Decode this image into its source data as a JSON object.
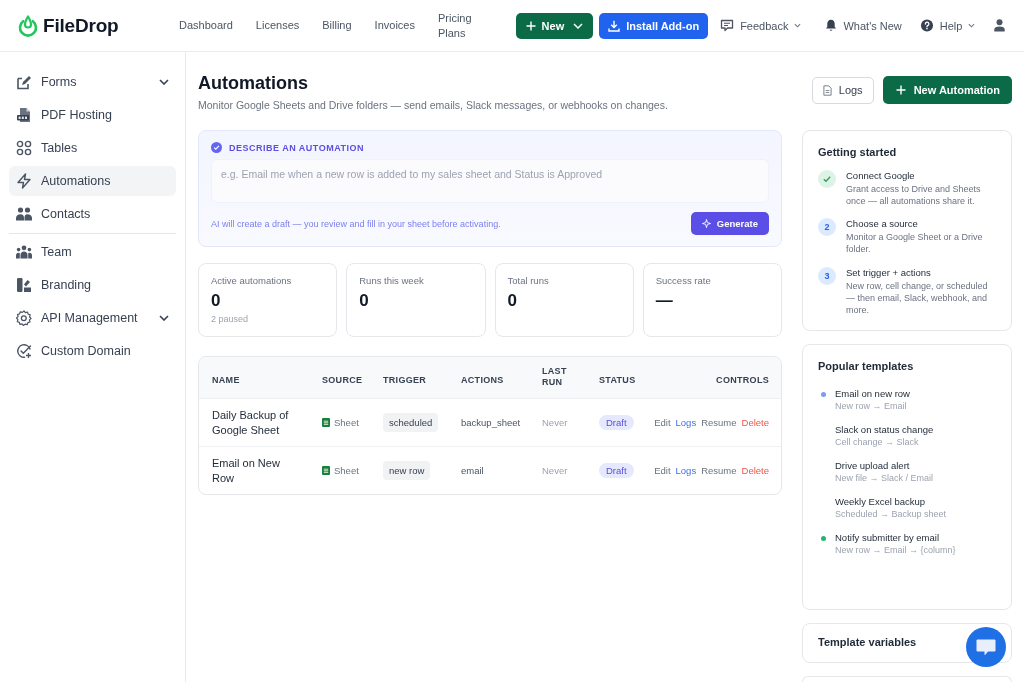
{
  "brand": {
    "name": "FileDrop"
  },
  "nav": [
    "Dashboard",
    "Licenses",
    "Billing",
    "Invoices",
    "Pricing Plans"
  ],
  "header_actions": {
    "new_button": "New",
    "install_button": "Install Add-on",
    "feedback": "Feedback",
    "whats_new": "What's New",
    "help": "Help"
  },
  "sidebar": {
    "sections": [
      {
        "items": [
          {
            "label": "Forms",
            "selected": false,
            "has_submenu": true
          },
          {
            "label": "PDF Hosting",
            "selected": false,
            "has_submenu": false
          },
          {
            "label": "Tables",
            "selected": false,
            "has_submenu": false
          },
          {
            "label": "Automations",
            "selected": true,
            "has_submenu": false
          },
          {
            "label": "Contacts",
            "selected": false,
            "has_submenu": false
          }
        ]
      },
      {
        "items": [
          {
            "label": "Team",
            "selected": false,
            "has_submenu": false
          },
          {
            "label": "Branding",
            "selected": false,
            "has_submenu": false
          },
          {
            "label": "API Management",
            "selected": false,
            "has_submenu": true
          },
          {
            "label": "Custom Domain",
            "selected": false,
            "has_submenu": false
          }
        ]
      }
    ]
  },
  "page": {
    "title": "Automations",
    "subtitle": "Monitor Google Sheets and Drive folders — send emails, Slack messages, or webhooks on changes.",
    "logs_button": "Logs",
    "new_button": "New Automation"
  },
  "ai_card": {
    "heading": "DESCRIBE AN AUTOMATION",
    "placeholder": "e.g. Email me when a new row is added to my sales sheet and Status is Approved",
    "hint": "AI will create a draft — you review and fill in your sheet before activating.",
    "button": "Generate"
  },
  "stats": [
    {
      "label": "Active automations",
      "value": "0",
      "note": "2 paused"
    },
    {
      "label": "Runs this week",
      "value": "0"
    },
    {
      "label": "Total runs",
      "value": "0"
    },
    {
      "label": "Success rate",
      "value": "—"
    }
  ],
  "table": {
    "columns": [
      "NAME",
      "SOURCE",
      "TRIGGER",
      "ACTIONS",
      "LAST RUN",
      "STATUS",
      "CONTROLS"
    ],
    "rows": [
      {
        "name": "Daily Backup of Google Sheet",
        "source": "Sheet",
        "trigger": "scheduled",
        "actions": "backup_sheet",
        "last_run": "Never",
        "status": "Draft",
        "controls": [
          {
            "label": "Edit",
            "kind": "plain"
          },
          {
            "label": "Logs",
            "kind": "link"
          },
          {
            "label": "Resume",
            "kind": "plain"
          },
          {
            "label": "Delete",
            "kind": "danger"
          }
        ]
      },
      {
        "name": "Email on New Row",
        "source": "Sheet",
        "trigger": "new row",
        "actions": "email",
        "last_run": "Never",
        "status": "Draft",
        "controls": [
          {
            "label": "Edit",
            "kind": "plain"
          },
          {
            "label": "Logs",
            "kind": "link"
          },
          {
            "label": "Resume",
            "kind": "plain"
          },
          {
            "label": "Delete",
            "kind": "danger"
          }
        ]
      }
    ]
  },
  "getting_started": {
    "title": "Getting started",
    "steps": [
      {
        "title": "Connect Google",
        "description": "Grant access to Drive and Sheets once — all automations share it.",
        "done": true
      },
      {
        "number": "2",
        "title": "Choose a source",
        "description": "Monitor a Google Sheet or a Drive folder.",
        "done": false
      },
      {
        "number": "3",
        "title": "Set trigger + actions",
        "description": "New row, cell change, or scheduled — then email, Slack, webhook, and more.",
        "done": false
      }
    ]
  },
  "popular_templates": {
    "title": "Popular templates",
    "items": [
      {
        "title": "Email on new row",
        "subtitle": "New row → Email",
        "color": "#7b9cf0"
      },
      {
        "title": "Slack on status change",
        "subtitle": "Cell change → Slack"
      },
      {
        "title": "Drive upload alert",
        "subtitle": "New file → Slack / Email"
      },
      {
        "title": "Weekly Excel backup",
        "subtitle": "Scheduled → Backup sheet"
      },
      {
        "title": "Notify submitter by email",
        "subtitle": "New row → Email → {column}",
        "color": "#22b573"
      }
    ]
  },
  "template_variables": {
    "title": "Template variables"
  }
}
